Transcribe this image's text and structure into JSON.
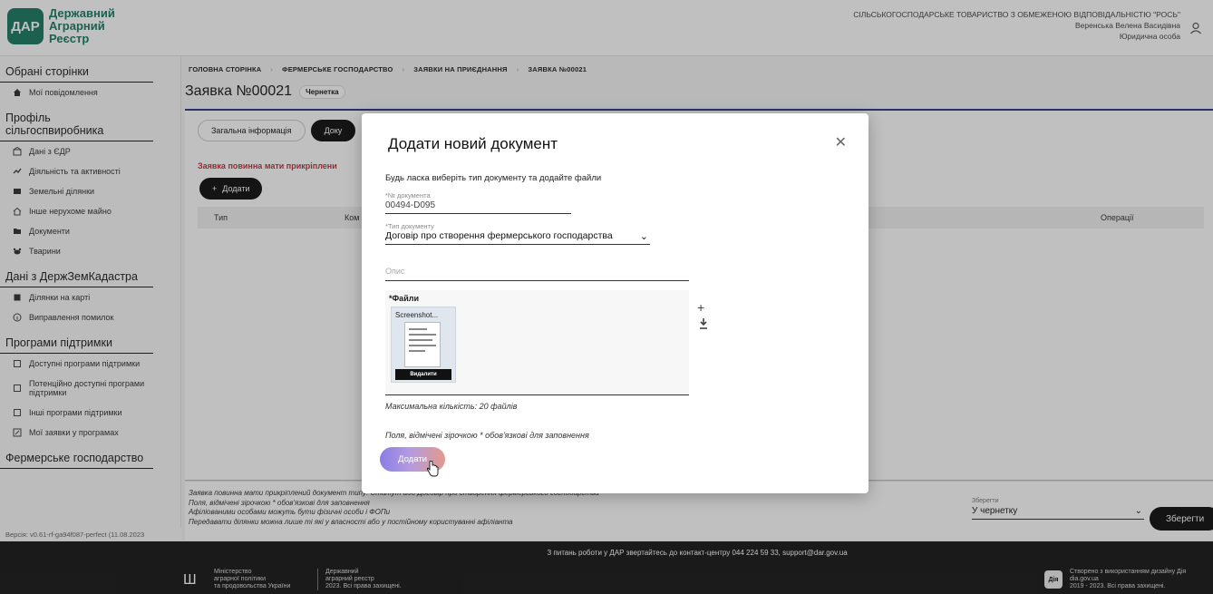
{
  "header": {
    "logo_abbr": "ДАР",
    "logo_line1": "Державний",
    "logo_line2": "Аграрний",
    "logo_line3": "Реєстр",
    "org_name": "СІЛЬСЬКОГОСПОДАРСЬКЕ ТОВАРИСТВО З ОБМЕЖЕНОЮ ВІДПОВІДАЛЬНІСТЮ \"РОСЬ\"",
    "user_name": "Веренська Велена Васидівна",
    "user_type": "Юридична особа"
  },
  "sidebar": {
    "section_favorites": "Обрані сторінки",
    "my_notifications": "Мої повідомлення",
    "section_profile": "Профіль сільгоспвиробника",
    "items_profile": [
      "Дані з ЄДР",
      "Діяльність та активності",
      "Земельні ділянки",
      "Інше нерухоме майно",
      "Документи",
      "Тварини"
    ],
    "section_cadastre": "Дані з ДержЗемКадастра",
    "items_cadastre": [
      "Ділянки на карті",
      "Виправлення помилок"
    ],
    "section_programs": "Програми підтримки",
    "items_programs": [
      "Доступні програми підтримки",
      "Потенційно доступні програми підтримки",
      "Інші програми підтримки",
      "Мої заявки у програмах"
    ],
    "section_farm": "Фермерське господарство",
    "version": "Версія: v0.61-rf-ga94f087-perfect (11.08.2023"
  },
  "main": {
    "breadcrumb": [
      "ГОЛОВНА СТОРІНКА",
      "ФЕРМЕРСЬКЕ ГОСПОДАРСТВО",
      "ЗАЯВКИ НА ПРИЄДНАННЯ",
      "ЗАЯВКА №00021"
    ],
    "title": "Заявка №00021",
    "status": "Чернетка",
    "tab_general": "Загальна інформація",
    "tab_docs": "Доку",
    "warning": "Заявка повинна мати прикріплени",
    "add_label": "Додати",
    "col_type": "Тип",
    "col_comment": "Ком",
    "col_ops": "Операції",
    "notes": [
      "Заявка повинна мати прикріплений документ типу: Статут або Договір про створення фермерського господарства",
      "Поля, відмічені зірочкою * обов'язкові для заповнення",
      "Афіліованими особами можуть бути фізичні особи і ФОПи",
      "Передавати ділянки можна лише ті які у власності або у постійному користуванні афіліанта"
    ],
    "save_as_label": "Зберегти",
    "save_as_value": "У чернетку",
    "save_button": "Зберегти"
  },
  "footer": {
    "contact": "З питань роботи у ДАР звертайтесь до контакт-центру 044 224 59 33, support@dar.gov.ua",
    "ministry_1": "Міністерство",
    "ministry_2": "аграрної політики",
    "ministry_3": "та продовольства України",
    "dar_1": "Державний",
    "dar_2": "аграрний реєстр",
    "dar_3": "2023. Всі права захищені.",
    "dia_logo": "Дія",
    "dia_1": "Створено з використанням дизайну Дія",
    "dia_2": "dia.gov.ua",
    "dia_3": "2019 - 2023. Всі права захищені."
  },
  "modal": {
    "title": "Додати новий документ",
    "subtitle": "Будь ласка виберіть тип документу та додайте файли",
    "doc_num_label": "*№ документа",
    "doc_num_value": "00494-D095",
    "doc_type_label": "*Тип документу",
    "doc_type_value": "Договір про створення фермерського господарства",
    "descr_placeholder": "Опис",
    "files_label": "*Файли",
    "file_name": "Screenshot...",
    "delete_label": "Видалити",
    "max_files": "Максимальна кількість: 20 файлів",
    "required_note": "Поля, відмічені зірочкою * обов'язкові для заповнення",
    "add_button": "Додати"
  },
  "colors": {
    "brand": "#1d7b64",
    "accent": "#2b3a8a",
    "warning": "#c0343d"
  },
  "icons": [
    "user-icon",
    "home-icon",
    "close-icon",
    "plus-icon",
    "download-icon",
    "chevron-down-icon",
    "trident-icon",
    "hand-cursor-icon"
  ]
}
